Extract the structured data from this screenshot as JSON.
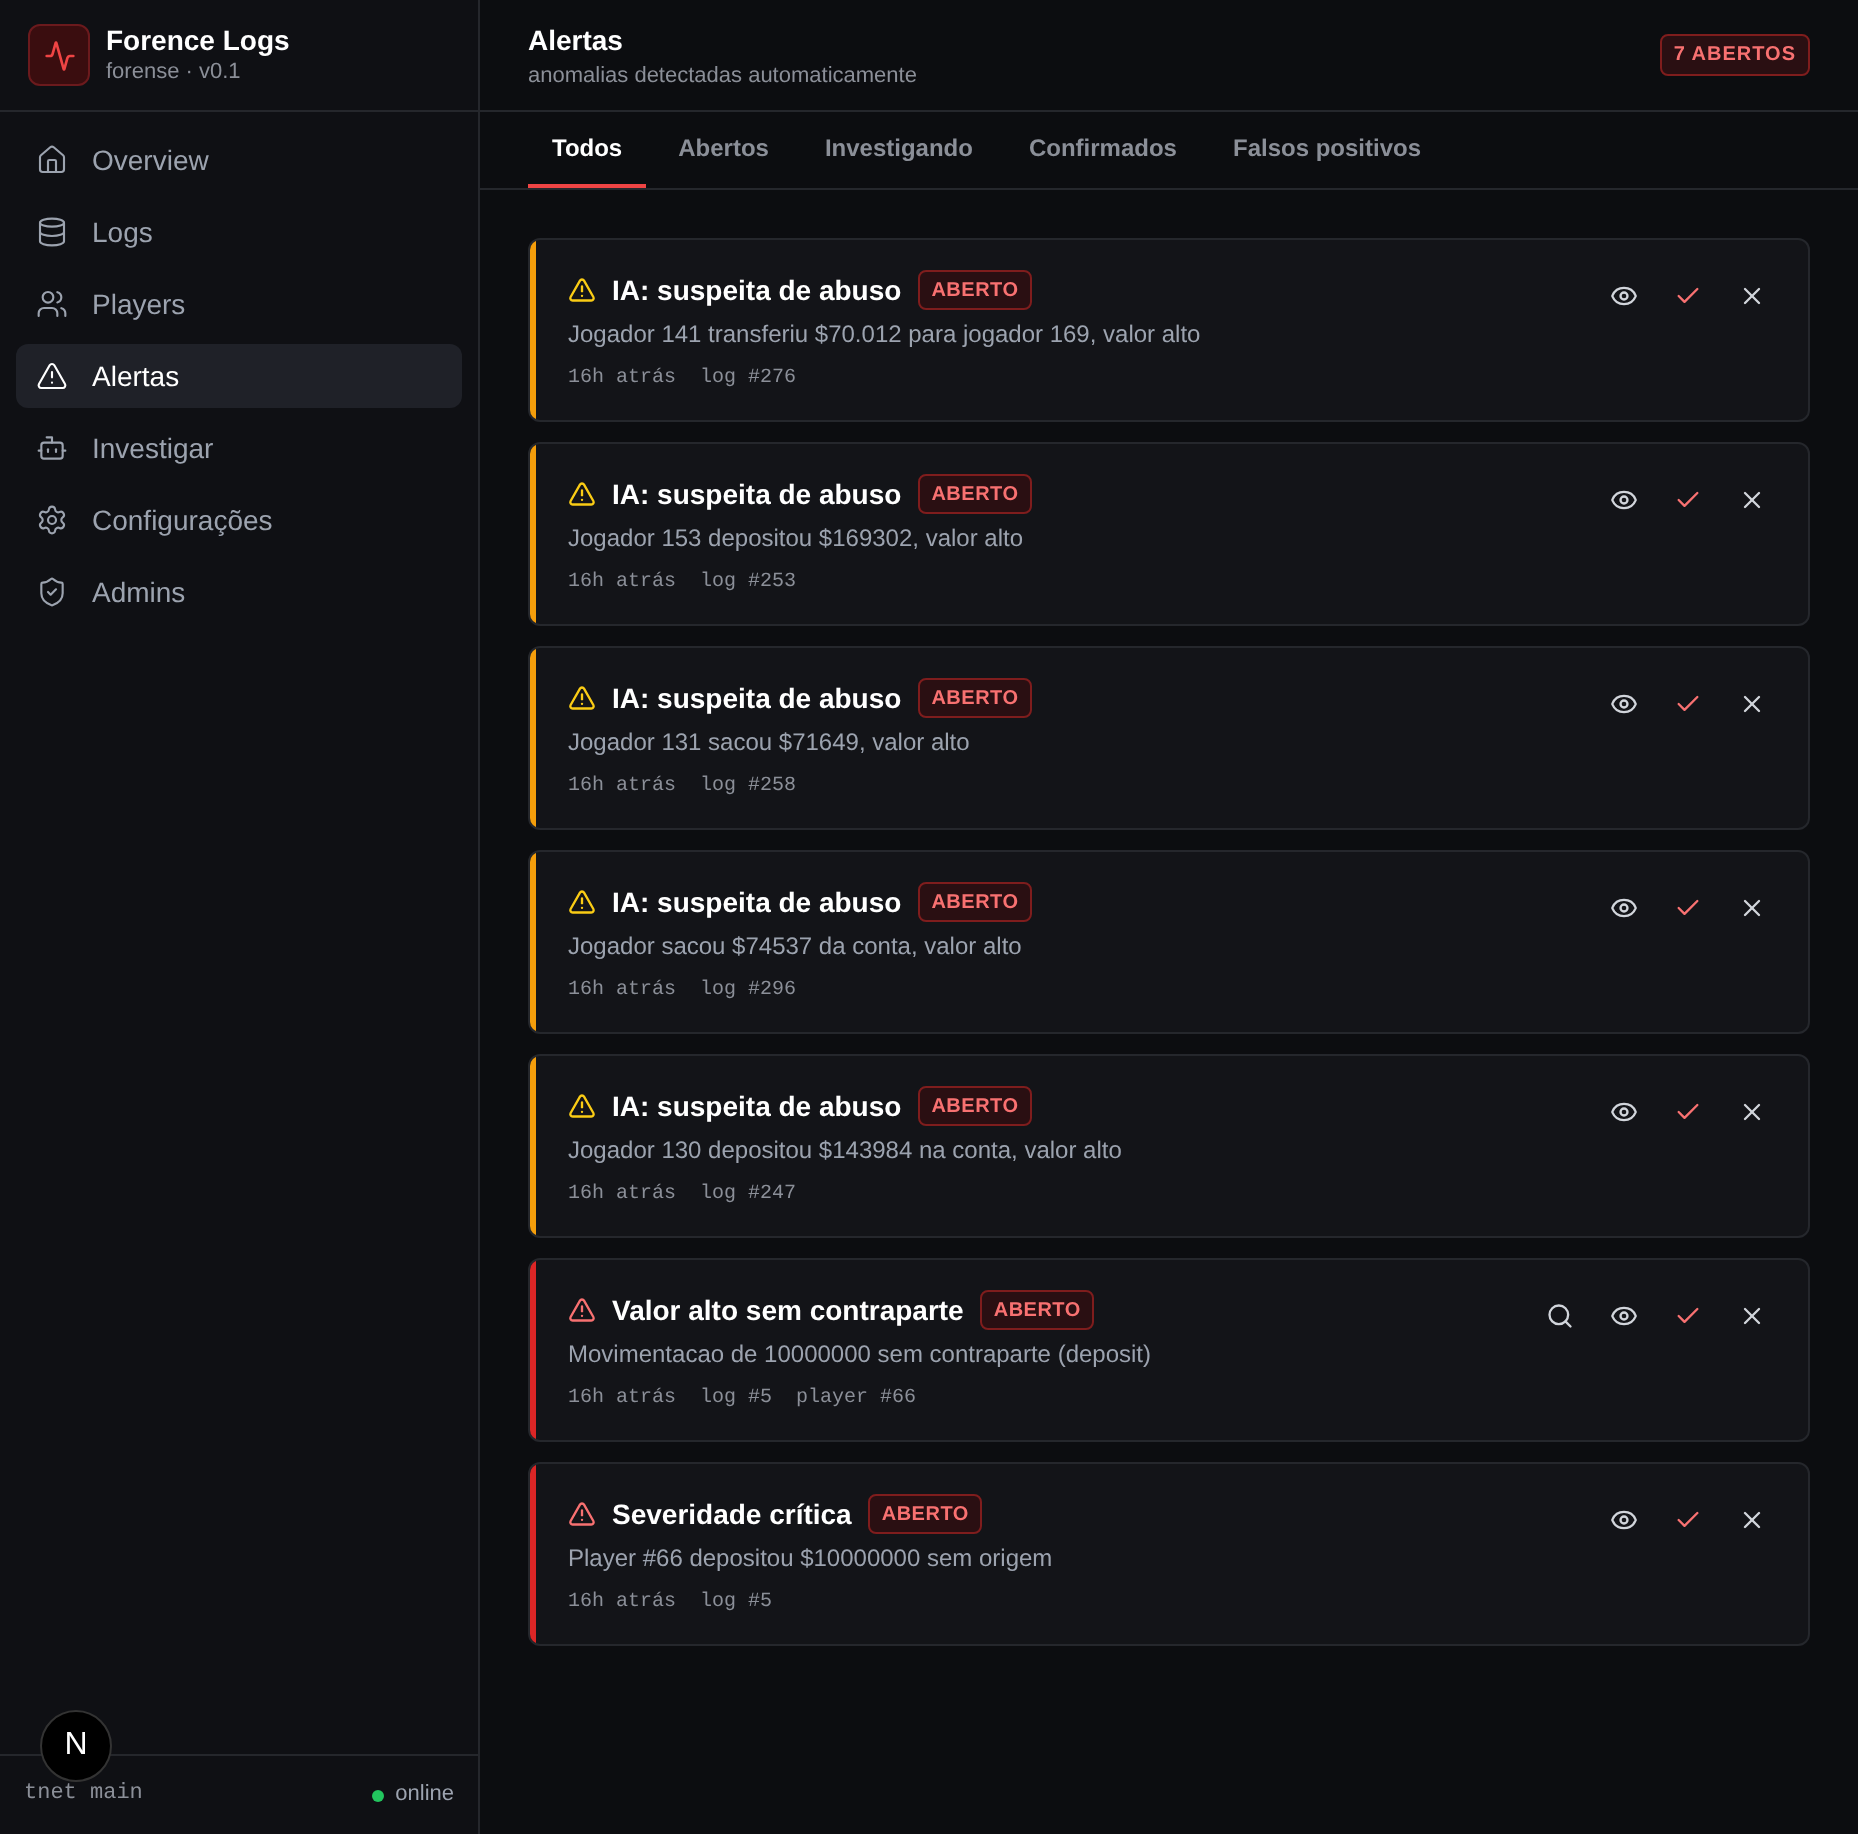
{
  "brand": {
    "title": "Forence Logs",
    "subtitle": "forense · v0.1"
  },
  "nav": [
    {
      "label": "Overview",
      "kind": "home",
      "selected": false
    },
    {
      "label": "Logs",
      "kind": "database",
      "selected": false
    },
    {
      "label": "Players",
      "kind": "users",
      "selected": false
    },
    {
      "label": "Alertas",
      "kind": "alert",
      "selected": true
    },
    {
      "label": "Investigar",
      "kind": "bot",
      "selected": false
    },
    {
      "label": "Configurações",
      "kind": "settings",
      "selected": false
    },
    {
      "label": "Admins",
      "kind": "shield",
      "selected": false
    }
  ],
  "footer": {
    "branch": "tnet main",
    "status": "online",
    "dev_badge": "N"
  },
  "header": {
    "title": "Alertas",
    "subtitle": "anomalias detectadas automaticamente",
    "badge": "7 ABERTOS"
  },
  "tabs": [
    {
      "label": "Todos",
      "selected": true
    },
    {
      "label": "Abertos",
      "selected": false
    },
    {
      "label": "Investigando",
      "selected": false
    },
    {
      "label": "Confirmados",
      "selected": false
    },
    {
      "label": "Falsos positivos",
      "selected": false
    }
  ],
  "alerts": [
    {
      "kind": "warning",
      "title": "IA: suspeita de abuso",
      "status": "ABERTO",
      "description": "Jogador 141 transferiu $70.012 para jogador 169, valor alto",
      "meta": [
        "16h atrás",
        "log #276"
      ],
      "investigate": false
    },
    {
      "kind": "warning",
      "title": "IA: suspeita de abuso",
      "status": "ABERTO",
      "description": "Jogador 153 depositou $169302, valor alto",
      "meta": [
        "16h atrás",
        "log #253"
      ],
      "investigate": false
    },
    {
      "kind": "warning",
      "title": "IA: suspeita de abuso",
      "status": "ABERTO",
      "description": "Jogador 131 sacou $71649, valor alto",
      "meta": [
        "16h atrás",
        "log #258"
      ],
      "investigate": false
    },
    {
      "kind": "warning",
      "title": "IA: suspeita de abuso",
      "status": "ABERTO",
      "description": "Jogador sacou $74537 da conta, valor alto",
      "meta": [
        "16h atrás",
        "log #296"
      ],
      "investigate": false
    },
    {
      "kind": "warning",
      "title": "IA: suspeita de abuso",
      "status": "ABERTO",
      "description": "Jogador 130 depositou $143984 na conta, valor alto",
      "meta": [
        "16h atrás",
        "log #247"
      ],
      "investigate": false
    },
    {
      "kind": "critical",
      "title": "Valor alto sem contraparte",
      "status": "ABERTO",
      "description": "Movimentacao de 10000000 sem contraparte (deposit)",
      "meta": [
        "16h atrás",
        "log #5",
        "player #66"
      ],
      "investigate": true
    },
    {
      "kind": "critical",
      "title": "Severidade crítica",
      "status": "ABERTO",
      "description": "Player #66 depositou $10000000 sem origem",
      "meta": [
        "16h atrás",
        "log #5"
      ],
      "investigate": false
    }
  ]
}
